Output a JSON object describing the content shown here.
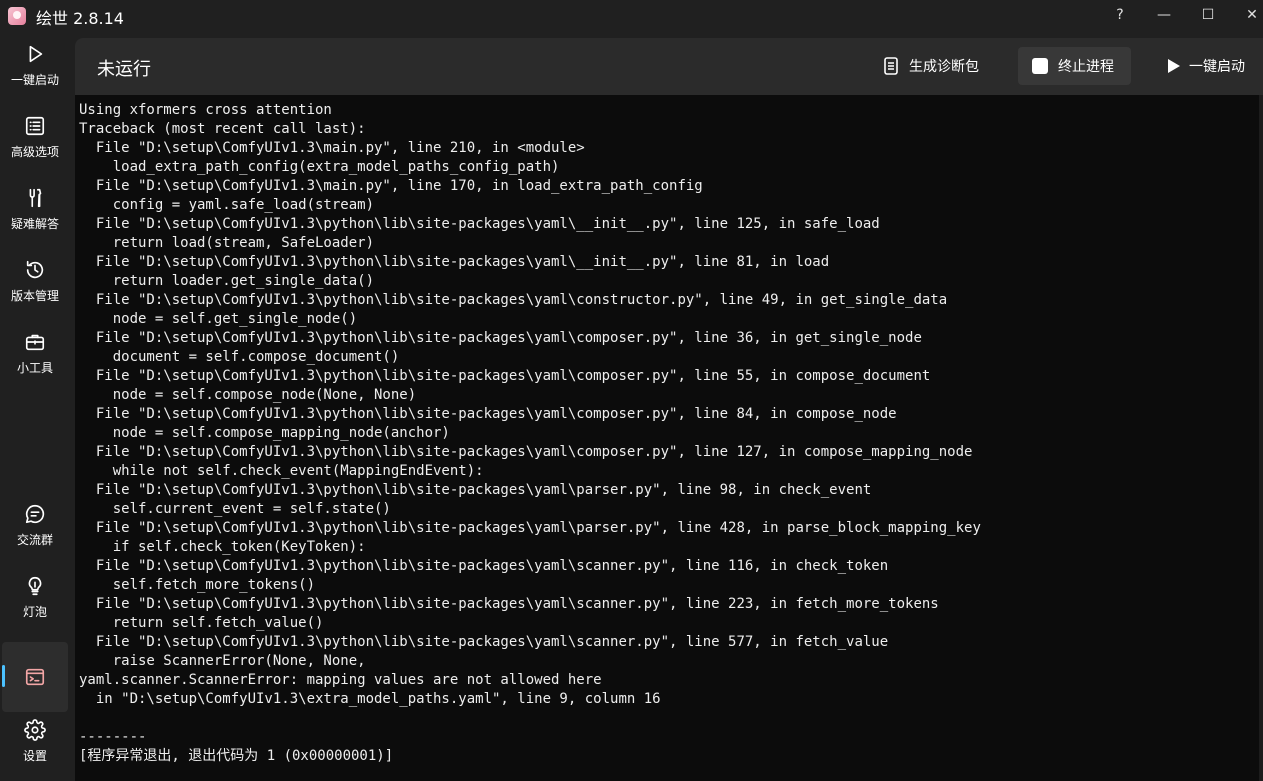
{
  "window": {
    "title": "绘世 2.8.14",
    "controls": {
      "help": "?",
      "minimize": "—",
      "maximize": "☐",
      "close": "✕"
    }
  },
  "sidebar": {
    "items": [
      {
        "label": "一键启动",
        "icon": "play-icon"
      },
      {
        "label": "高级选项",
        "icon": "list-icon"
      },
      {
        "label": "疑难解答",
        "icon": "tools-icon"
      },
      {
        "label": "版本管理",
        "icon": "history-icon"
      },
      {
        "label": "小工具",
        "icon": "toolbox-icon"
      },
      {
        "label": "交流群",
        "icon": "chat-icon"
      },
      {
        "label": "灯泡",
        "icon": "lightbulb-icon"
      },
      {
        "label": "",
        "icon": "terminal-icon",
        "active": true
      },
      {
        "label": "设置",
        "icon": "gear-icon"
      }
    ]
  },
  "header": {
    "status": "未运行",
    "diag_label": "生成诊断包",
    "stop_label": "终止进程",
    "start_label": "一键启动"
  },
  "console": {
    "lines": [
      "Using xformers cross attention",
      "Traceback (most recent call last):",
      "  File \"D:\\setup\\ComfyUIv1.3\\main.py\", line 210, in <module>",
      "    load_extra_path_config(extra_model_paths_config_path)",
      "  File \"D:\\setup\\ComfyUIv1.3\\main.py\", line 170, in load_extra_path_config",
      "    config = yaml.safe_load(stream)",
      "  File \"D:\\setup\\ComfyUIv1.3\\python\\lib\\site-packages\\yaml\\__init__.py\", line 125, in safe_load",
      "    return load(stream, SafeLoader)",
      "  File \"D:\\setup\\ComfyUIv1.3\\python\\lib\\site-packages\\yaml\\__init__.py\", line 81, in load",
      "    return loader.get_single_data()",
      "  File \"D:\\setup\\ComfyUIv1.3\\python\\lib\\site-packages\\yaml\\constructor.py\", line 49, in get_single_data",
      "    node = self.get_single_node()",
      "  File \"D:\\setup\\ComfyUIv1.3\\python\\lib\\site-packages\\yaml\\composer.py\", line 36, in get_single_node",
      "    document = self.compose_document()",
      "  File \"D:\\setup\\ComfyUIv1.3\\python\\lib\\site-packages\\yaml\\composer.py\", line 55, in compose_document",
      "    node = self.compose_node(None, None)",
      "  File \"D:\\setup\\ComfyUIv1.3\\python\\lib\\site-packages\\yaml\\composer.py\", line 84, in compose_node",
      "    node = self.compose_mapping_node(anchor)",
      "  File \"D:\\setup\\ComfyUIv1.3\\python\\lib\\site-packages\\yaml\\composer.py\", line 127, in compose_mapping_node",
      "    while not self.check_event(MappingEndEvent):",
      "  File \"D:\\setup\\ComfyUIv1.3\\python\\lib\\site-packages\\yaml\\parser.py\", line 98, in check_event",
      "    self.current_event = self.state()",
      "  File \"D:\\setup\\ComfyUIv1.3\\python\\lib\\site-packages\\yaml\\parser.py\", line 428, in parse_block_mapping_key",
      "    if self.check_token(KeyToken):",
      "  File \"D:\\setup\\ComfyUIv1.3\\python\\lib\\site-packages\\yaml\\scanner.py\", line 116, in check_token",
      "    self.fetch_more_tokens()",
      "  File \"D:\\setup\\ComfyUIv1.3\\python\\lib\\site-packages\\yaml\\scanner.py\", line 223, in fetch_more_tokens",
      "    return self.fetch_value()",
      "  File \"D:\\setup\\ComfyUIv1.3\\python\\lib\\site-packages\\yaml\\scanner.py\", line 577, in fetch_value",
      "    raise ScannerError(None, None,",
      "yaml.scanner.ScannerError: mapping values are not allowed here",
      "  in \"D:\\setup\\ComfyUIv1.3\\extra_model_paths.yaml\", line 9, column 16",
      "",
      "--------",
      "[程序异常退出, 退出代码为 1 (0x00000001)]"
    ]
  },
  "colors": {
    "accent": "#4cc2ff",
    "console_bg": "#0c0c0c",
    "header_bg": "#2b2b2b",
    "sidebar_bg": "#202020"
  }
}
